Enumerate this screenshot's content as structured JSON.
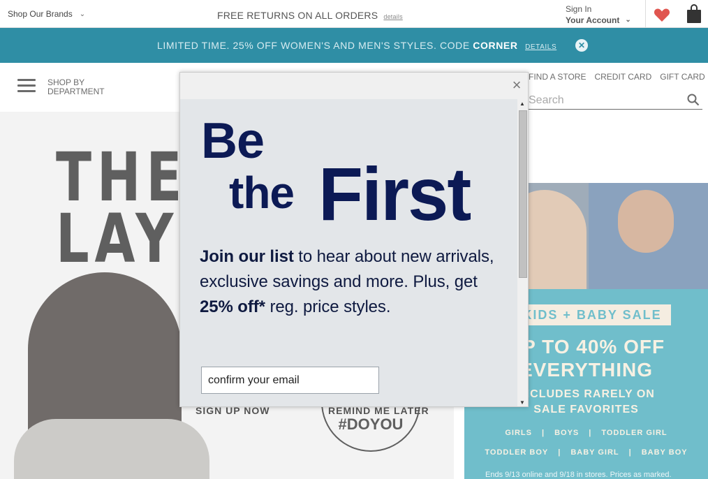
{
  "utility": {
    "brands_label": "Shop Our Brands",
    "returns_text": "FREE RETURNS ON ALL ORDERS",
    "returns_details": "details",
    "sign_in": "Sign In",
    "account": "Your Account"
  },
  "promo": {
    "text": "LIMITED TIME. 25% OFF WOMEN'S AND MEN'S STYLES. CODE",
    "code": "CORNER",
    "details": "DETAILS",
    "close_glyph": "✕"
  },
  "nav": {
    "shop_line1": "SHOP BY",
    "shop_line2": "DEPARTMENT",
    "links": [
      "FIND A STORE",
      "CREDIT CARD",
      "GIFT CARD"
    ],
    "search_placeholder": "Search"
  },
  "background": {
    "hero_title_line1": "THE",
    "hero_title_line2": "LAY",
    "doyou": "#DOYOU",
    "signup": "SIGN UP NOW",
    "remind": "REMIND ME LATER",
    "kids_banner": "KIDS + BABY SALE",
    "upto_line1": "UP TO 40% OFF",
    "upto_line2": "EVERYTHING",
    "rarely_line1": "INCLUDES RARELY ON",
    "rarely_line2": "SALE FAVORITES",
    "cats_row1": [
      "GIRLS",
      "|",
      "BOYS",
      "|",
      "TODDLER GIRL"
    ],
    "cats_row2": [
      "TODDLER BOY",
      "|",
      "BABY GIRL",
      "|",
      "BABY BOY"
    ],
    "fine_print": "Ends 9/13 online and 9/18 in stores. Prices as marked."
  },
  "modal": {
    "close_glyph": "×",
    "headline_be": "Be",
    "headline_the": "the",
    "headline_first": "First",
    "copy_bold1": "Join our list",
    "copy_text1": " to hear about new arrivals, exclusive savings and more. Plus, get ",
    "copy_bold2": "25% off*",
    "copy_text2": " reg. price styles.",
    "email_placeholder": "confirm your email"
  },
  "colors": {
    "promo_bg": "#2f8ea5",
    "headline": "#0c1a55",
    "modal_bg": "#e3e6e9",
    "kids_panel": "#3aa6b8"
  }
}
